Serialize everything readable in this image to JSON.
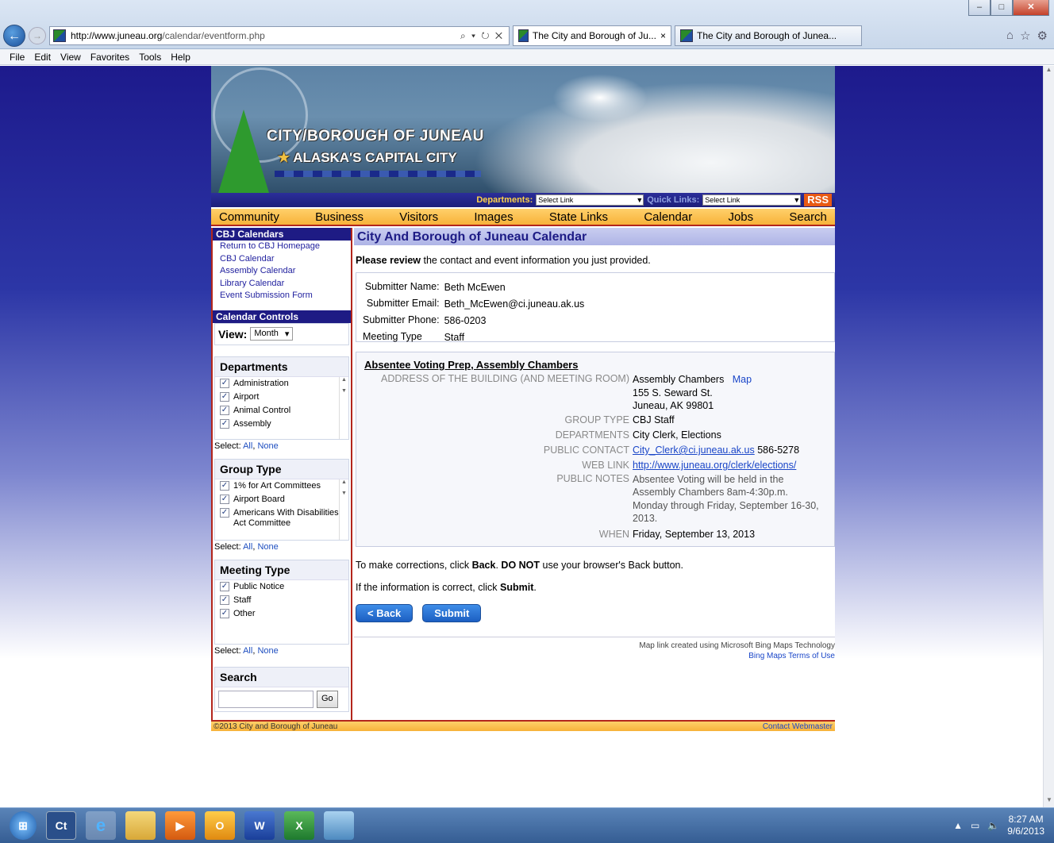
{
  "browser": {
    "url_host": "http://www.juneau.org",
    "url_path": "/calendar/eventform.php",
    "addr_tools": "⌕ ▾ ↻ ✕",
    "tabs": [
      "The City and Borough of Ju...",
      "The City and Borough of Junea..."
    ],
    "tab_close": "×",
    "menu": [
      "File",
      "Edit",
      "View",
      "Favorites",
      "Tools",
      "Help"
    ],
    "window_buttons": [
      "–",
      "□",
      "✕"
    ],
    "tool_icons": [
      "⌂",
      "☆",
      "⚙"
    ]
  },
  "banner": {
    "title_line1": "CITY/BOROUGH OF JUNEAU",
    "title_line2": "ALASKA'S CAPITAL CITY",
    "departments_label": "Departments:",
    "departments_value": "Select Link",
    "quicklinks_label": "Quick Links:",
    "quicklinks_value": "Select Link",
    "rss": "RSS"
  },
  "nav": [
    "Community",
    "Business",
    "Visitors",
    "Images",
    "State Links",
    "Calendar",
    "Jobs",
    "Search"
  ],
  "sidebar": {
    "cbj_header": "CBJ Calendars",
    "cbj_links": [
      "Return to CBJ Homepage",
      "CBJ Calendar",
      "Assembly Calendar",
      "Library Calendar",
      "Event Submission Form"
    ],
    "controls_header": "Calendar Controls",
    "view_label": "View:",
    "view_value": "Month",
    "departments_title": "Departments",
    "departments": [
      "Administration",
      "Airport",
      "Animal Control",
      "Assembly"
    ],
    "group_type_title": "Group Type",
    "group_types": [
      "1% for Art Committees",
      "Airport Board",
      "Americans With Disabilities Act Committee"
    ],
    "meeting_type_title": "Meeting Type",
    "meeting_types": [
      "Public Notice",
      "Staff",
      "Other"
    ],
    "select_label": "Select:",
    "select_all": "All",
    "select_none": "None",
    "search_title": "Search",
    "search_go": "Go"
  },
  "main": {
    "title": "City And Borough of Juneau Calendar",
    "review_bold": "Please review",
    "review_rest": " the contact and event information you just provided.",
    "submitter": {
      "name_label": "Submitter Name:",
      "name": "Beth McEwen",
      "email_label": "Submitter Email:",
      "email": "Beth_McEwen@ci.juneau.ak.us",
      "phone_label": "Submitter Phone:",
      "phone": "586-0203",
      "meeting_type_label": "Meeting Type",
      "meeting_type": "Staff"
    },
    "event": {
      "title": "Absentee Voting Prep, Assembly Chambers",
      "address_label": "ADDRESS OF THE BUILDING (AND MEETING ROOM)",
      "address_line1": "Assembly Chambers",
      "map_link": "Map",
      "address_line2": "155 S. Seward St.",
      "address_line3": "Juneau, AK 99801",
      "group_type_label": "GROUP TYPE",
      "group_type": "CBJ Staff",
      "departments_label": "DEPARTMENTS",
      "departments": "City Clerk, Elections",
      "contact_label": "PUBLIC CONTACT",
      "contact_email": "City_Clerk@ci.juneau.ak.us",
      "contact_phone": " 586-5278",
      "weblink_label": "WEB LINK",
      "weblink": "http://www.juneau.org/clerk/elections/",
      "notes_label": "PUBLIC NOTES",
      "notes": "Absentee Voting will be held in the Assembly Chambers 8am-4:30p.m. Monday through Friday, September 16-30, 2013.",
      "when_label": "WHEN",
      "when": "Friday, September 13, 2013"
    },
    "corrections_pre": "To make corrections, click ",
    "corrections_back": "Back",
    "corrections_mid": ". ",
    "corrections_donot": "DO NOT",
    "corrections_post": " use your browser's Back button.",
    "correct_pre": "If the information is correct, click ",
    "correct_submit": "Submit",
    "correct_post": ".",
    "back_button": "< Back",
    "submit_button": "Submit",
    "map_credit": "Map link created using Microsoft Bing Maps Technology",
    "bing_terms": "Bing Maps Terms of Use"
  },
  "footer": {
    "copyright": "©2013 City and Borough of Juneau",
    "contact": "Contact Webmaster"
  },
  "taskbar": {
    "time": "8:27 AM",
    "date": "9/6/2013",
    "ct_label": "Ct"
  }
}
